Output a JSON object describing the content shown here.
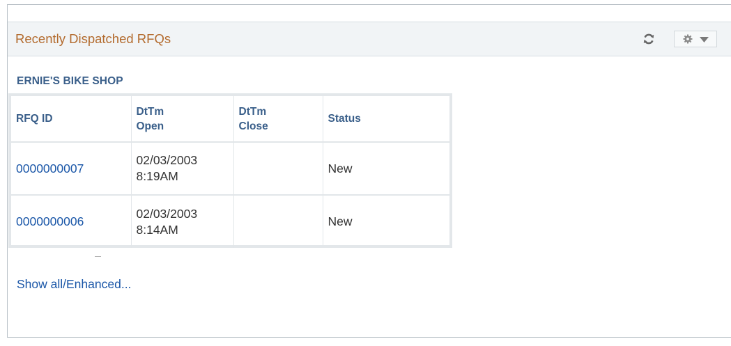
{
  "pagelet": {
    "title": "Recently Dispatched RFQs",
    "icons": {
      "refresh": "refresh-icon",
      "options": "gear-icon"
    }
  },
  "organization": "ERNIE'S BIKE SHOP",
  "table": {
    "headers": {
      "rfq_id": "RFQ ID",
      "open_line1": "DtTm",
      "open_line2": "Open",
      "close_line1": "DtTm",
      "close_line2": "Close",
      "status": "Status"
    },
    "rows": [
      {
        "rfq_id": "0000000007",
        "open_date": "02/03/2003",
        "open_time": "8:19AM",
        "close": "",
        "status": "New"
      },
      {
        "rfq_id": "0000000006",
        "open_date": "02/03/2003",
        "open_time": "8:14AM",
        "close": "",
        "status": "New"
      }
    ]
  },
  "footer": {
    "show_all_label": "Show all/Enhanced..."
  },
  "colors": {
    "title": "#b36b2e",
    "header_text": "#3a5f8a",
    "link": "#1b57a8",
    "header_bg": "#f1f4f6"
  }
}
